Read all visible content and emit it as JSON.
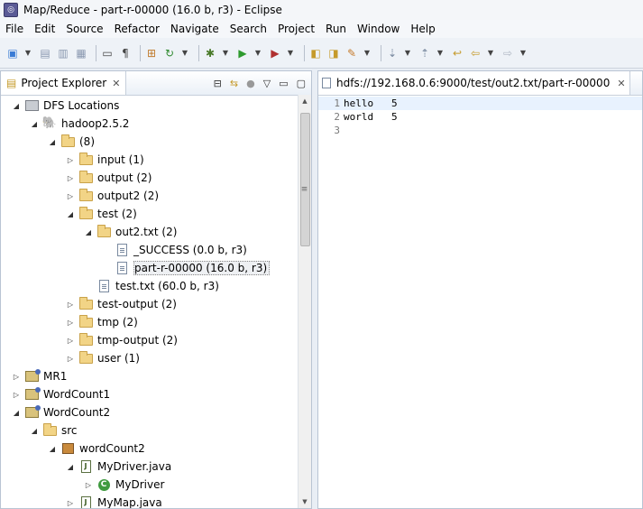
{
  "window": {
    "title": "Map/Reduce - part-r-00000 (16.0 b, r3) - Eclipse"
  },
  "menu": [
    "File",
    "Edit",
    "Source",
    "Refactor",
    "Navigate",
    "Search",
    "Project",
    "Run",
    "Window",
    "Help"
  ],
  "toolbar_icons": [
    "new-icon",
    "save-icon",
    "save-all-icon",
    "print-icon",
    "terminal-icon",
    "paragraph-icon",
    "new-package-icon",
    "refresh-icon",
    "debug-icon",
    "run-icon",
    "external-tools-icon",
    "open-type-icon",
    "open-folder-icon",
    "pen-icon",
    "next-annotation-icon",
    "previous-annotation-icon",
    "last-edit-icon",
    "back-icon",
    "forward-icon"
  ],
  "project_explorer": {
    "tab_label": "Project Explorer",
    "tree": [
      {
        "label": "DFS Locations",
        "depth": 0,
        "expanded": true,
        "icon": "dfs-icon"
      },
      {
        "label": "hadoop2.5.2",
        "depth": 1,
        "expanded": true,
        "icon": "elephant-icon"
      },
      {
        "label": "(8)",
        "depth": 2,
        "expanded": true,
        "icon": "folder-icon"
      },
      {
        "label": "input (1)",
        "depth": 3,
        "expanded": false,
        "icon": "folder-icon"
      },
      {
        "label": "output (2)",
        "depth": 3,
        "expanded": false,
        "icon": "folder-icon"
      },
      {
        "label": "output2 (2)",
        "depth": 3,
        "expanded": false,
        "icon": "folder-icon"
      },
      {
        "label": "test (2)",
        "depth": 3,
        "expanded": true,
        "icon": "folder-icon"
      },
      {
        "label": "out2.txt (2)",
        "depth": 4,
        "expanded": true,
        "icon": "folder-icon"
      },
      {
        "label": "_SUCCESS (0.0 b, r3)",
        "depth": 5,
        "expanded": null,
        "icon": "file-icon"
      },
      {
        "label": "part-r-00000 (16.0 b, r3)",
        "depth": 5,
        "expanded": null,
        "icon": "file-icon",
        "selected": true
      },
      {
        "label": "test.txt (60.0 b, r3)",
        "depth": 4,
        "expanded": null,
        "icon": "file-icon"
      },
      {
        "label": "test-output (2)",
        "depth": 3,
        "expanded": false,
        "icon": "folder-icon"
      },
      {
        "label": "tmp (2)",
        "depth": 3,
        "expanded": false,
        "icon": "folder-icon"
      },
      {
        "label": "tmp-output (2)",
        "depth": 3,
        "expanded": false,
        "icon": "folder-icon"
      },
      {
        "label": "user (1)",
        "depth": 3,
        "expanded": false,
        "icon": "folder-icon"
      },
      {
        "label": "MR1",
        "depth": 0,
        "expanded": false,
        "icon": "project-icon"
      },
      {
        "label": "WordCount1",
        "depth": 0,
        "expanded": false,
        "icon": "project-icon"
      },
      {
        "label": "WordCount2",
        "depth": 0,
        "expanded": true,
        "icon": "project-icon"
      },
      {
        "label": "src",
        "depth": 1,
        "expanded": true,
        "icon": "source-folder-icon"
      },
      {
        "label": "wordCount2",
        "depth": 2,
        "expanded": true,
        "icon": "package-icon"
      },
      {
        "label": "MyDriver.java",
        "depth": 3,
        "expanded": true,
        "icon": "java-file-icon"
      },
      {
        "label": "MyDriver",
        "depth": 4,
        "expanded": false,
        "icon": "class-icon"
      },
      {
        "label": "MyMap.java",
        "depth": 3,
        "expanded": false,
        "icon": "java-file-icon"
      }
    ]
  },
  "editor": {
    "tab_label": "hdfs://192.168.0.6:9000/test/out2.txt/part-r-00000",
    "lines": [
      {
        "num": "1",
        "text": "hello\t5"
      },
      {
        "num": "2",
        "text": "world\t5"
      },
      {
        "num": "3",
        "text": ""
      }
    ]
  }
}
